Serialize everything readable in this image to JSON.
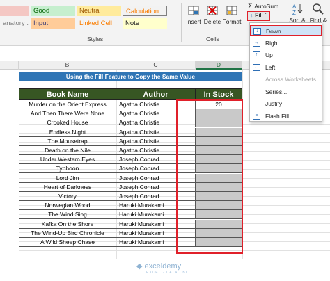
{
  "styles": {
    "label": "Styles",
    "cells": [
      {
        "text": "",
        "bg": "#f4c7c3",
        "color": "#9c0006"
      },
      {
        "text": "Good",
        "bg": "#c6efce",
        "color": "#006100"
      },
      {
        "text": "Neutral",
        "bg": "#ffeb9c",
        "color": "#9c5700"
      },
      {
        "text": "Calculation",
        "bg": "#f2f2f2",
        "color": "#fa7d00"
      },
      {
        "text": "anatory ...",
        "bg": "#f3f3f3",
        "color": "#7f7f7f"
      },
      {
        "text": "Input",
        "bg": "#ffcc99",
        "color": "#3f3f76"
      },
      {
        "text": "Linked Cell",
        "bg": "#f3f3f3",
        "color": "#fa7d00"
      },
      {
        "text": "Note",
        "bg": "#ffffcc",
        "color": "#222222"
      }
    ]
  },
  "cells_group": {
    "label": "Cells",
    "insert": "Insert",
    "delete": "Delete",
    "format": "Format"
  },
  "editing": {
    "autosum": "AutoSum",
    "fill": "Fill ˇ",
    "sort": "Sort &",
    "find": "Find &"
  },
  "fill_menu": {
    "items": [
      {
        "label": "Down",
        "icon": "↓",
        "disabled": false,
        "active": true
      },
      {
        "label": "Right",
        "icon": "→",
        "disabled": false,
        "active": false
      },
      {
        "label": "Up",
        "icon": "↑",
        "disabled": false,
        "active": false
      },
      {
        "label": "Left",
        "icon": "←",
        "disabled": false,
        "active": false
      },
      {
        "label": "Across Worksheets...",
        "icon": "",
        "disabled": true,
        "active": false
      },
      {
        "label": "Series...",
        "icon": "",
        "disabled": false,
        "active": false
      },
      {
        "label": "Justify",
        "icon": "",
        "disabled": false,
        "active": false
      },
      {
        "label": "Flash Fill",
        "icon": "≡",
        "disabled": false,
        "active": false
      }
    ]
  },
  "columns": {
    "b": "B",
    "c": "C",
    "d": "D"
  },
  "sheet": {
    "banner": "Using the Fill Feature to Copy the Same Value",
    "headers": {
      "book": "Book Name",
      "author": "Author",
      "stock": "In Stock"
    },
    "rows": [
      {
        "book": "Murder on the Orient Express",
        "author": "Agatha Christie",
        "stock": "20"
      },
      {
        "book": "And Then There Were None",
        "author": "Agatha Christie",
        "stock": ""
      },
      {
        "book": "Crooked House",
        "author": "Agatha Christie",
        "stock": ""
      },
      {
        "book": "Endless Night",
        "author": "Agatha Christie",
        "stock": ""
      },
      {
        "book": "The Mousetrap",
        "author": "Agatha Christie",
        "stock": ""
      },
      {
        "book": "Death on the Nile",
        "author": "Agatha Christie",
        "stock": ""
      },
      {
        "book": "Under Western Eyes",
        "author": "Joseph Conrad",
        "stock": ""
      },
      {
        "book": "Typhoon",
        "author": "Joseph Conrad",
        "stock": ""
      },
      {
        "book": "Lord Jim",
        "author": "Joseph Conrad",
        "stock": ""
      },
      {
        "book": "Heart of Darkness",
        "author": "Joseph Conrad",
        "stock": ""
      },
      {
        "book": "Victory",
        "author": "Joseph Conrad",
        "stock": ""
      },
      {
        "book": "Norwegian Wood",
        "author": "Haruki Murakami",
        "stock": ""
      },
      {
        "book": "The Wind Sing",
        "author": "Haruki Murakami",
        "stock": ""
      },
      {
        "book": "Kafka On the Shore",
        "author": "Haruki Murakami",
        "stock": ""
      },
      {
        "book": "The Wind-Up Bird Chronicle",
        "author": "Haruki Murakami",
        "stock": ""
      },
      {
        "book": "A Wild Sheep Chase",
        "author": "Haruki Murakami",
        "stock": ""
      }
    ]
  },
  "watermark": {
    "name": "exceldemy",
    "tagline": "EXCEL · DATA · BI"
  }
}
